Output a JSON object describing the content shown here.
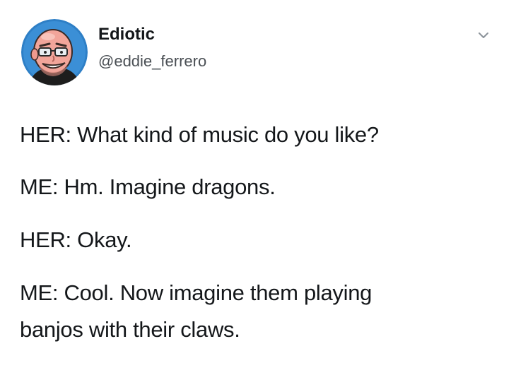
{
  "author": {
    "display_name": "Ediotic",
    "handle": "@eddie_ferrero",
    "avatar_icon": "cartoon-bald-man-with-glasses-avatar"
  },
  "menu": {
    "icon": "chevron-down-icon"
  },
  "tweet": {
    "lines": [
      "HER: What kind of music do you like?",
      "ME: Hm. Imagine dragons.",
      "HER: Okay.",
      "ME: Cool. Now imagine them playing",
      "banjos with their claws."
    ]
  },
  "colors": {
    "text": "#14171a",
    "handle": "#4a4f54",
    "avatar_background": "#2e7fc6",
    "skin": "#f2a59a"
  }
}
